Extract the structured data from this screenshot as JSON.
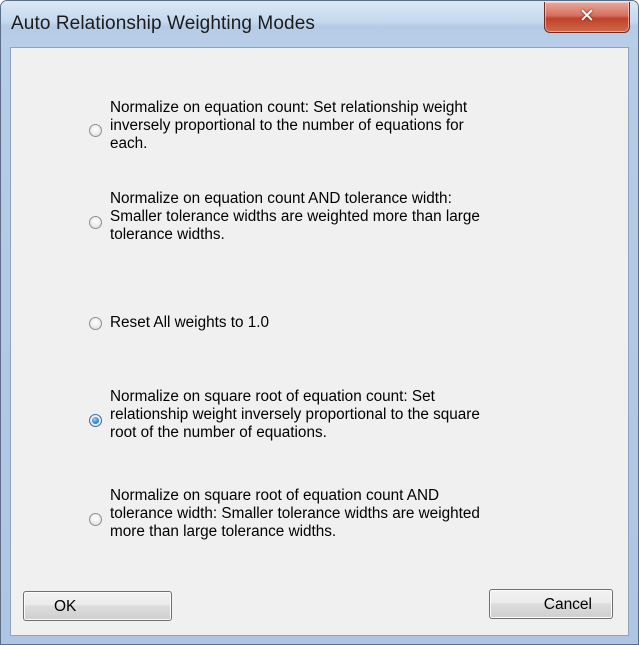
{
  "window": {
    "title": "Auto Relationship Weighting Modes",
    "close_glyph": "✕"
  },
  "options": [
    {
      "lines": [
        "Normalize on equation count: Set relationship weight",
        "inversely proportional to the number of equations for",
        "each."
      ],
      "checked": false
    },
    {
      "lines": [
        "Normalize on equation count AND tolerance width:",
        "Smaller tolerance widths are weighted more than large",
        "tolerance widths."
      ],
      "checked": false
    },
    {
      "lines": [
        "Reset All weights to 1.0"
      ],
      "checked": false
    },
    {
      "lines": [
        "Normalize on square root of equation count: Set",
        "relationship weight inversely proportional to the square",
        "root of the number of equations."
      ],
      "checked": true
    },
    {
      "lines": [
        "Normalize on square root of equation count AND",
        "tolerance width: Smaller tolerance widths are weighted",
        "more than large tolerance widths."
      ],
      "checked": false
    }
  ],
  "buttons": {
    "ok_label": "OK",
    "cancel_label": "Cancel"
  },
  "colors": {
    "accent": "#3b8fd9",
    "close_button": "#c0412a",
    "dialog_background": "#f0f0f0"
  }
}
